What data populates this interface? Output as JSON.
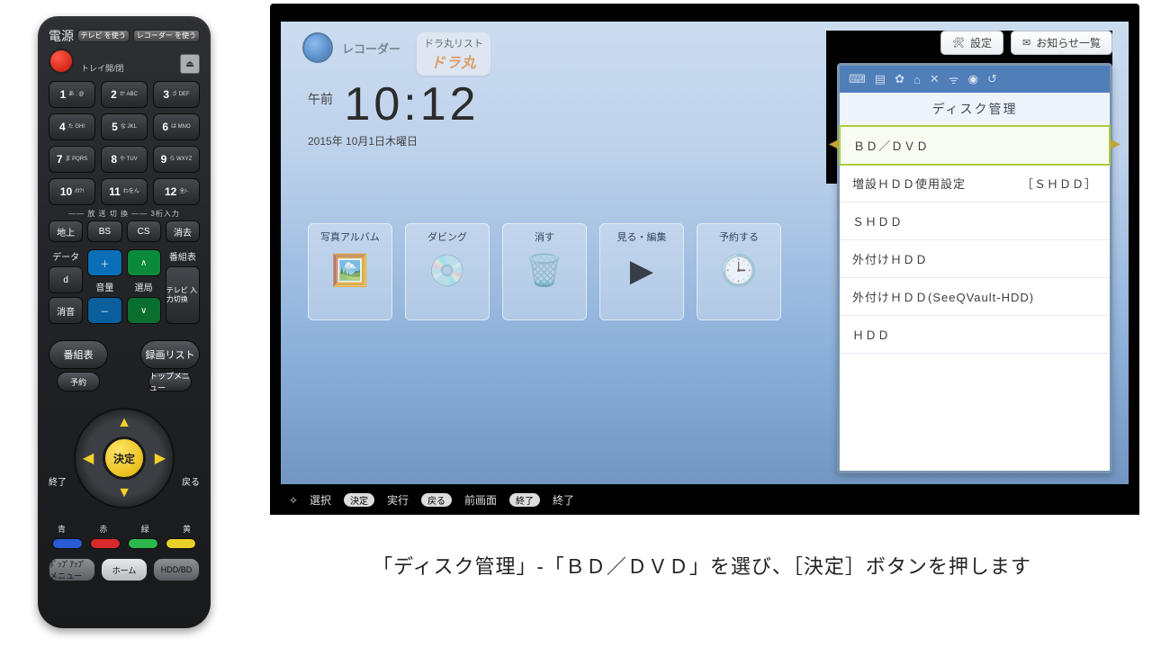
{
  "remote": {
    "power_label": "電源",
    "top_mini": {
      "tv": "テレビ\nを使う",
      "rec": "レコーダー\nを使う"
    },
    "tray": "トレイ開/閉",
    "numpad": [
      {
        "n": "1",
        "s": "あ\n. @"
      },
      {
        "n": "2",
        "s": "か\nABC"
      },
      {
        "n": "3",
        "s": "さ\nDEF"
      },
      {
        "n": "4",
        "s": "た\nGHI"
      },
      {
        "n": "5",
        "s": "な\nJKL"
      },
      {
        "n": "6",
        "s": "は\nMNO"
      },
      {
        "n": "7",
        "s": "ま\nPQRS"
      },
      {
        "n": "8",
        "s": "や\nTUV"
      },
      {
        "n": "9",
        "s": "ら\nWXYZ"
      },
      {
        "n": "10",
        "s": "/0?!"
      },
      {
        "n": "11",
        "s": "わをん"
      },
      {
        "n": "12",
        "s": "全/-"
      }
    ],
    "div": "―― 放 送 切 換 ―― 3桁入力",
    "src": [
      "地上",
      "BS",
      "CS",
      "消去"
    ],
    "left_col": {
      "data": "データ",
      "d": "d",
      "mute": "消音"
    },
    "vol": "音量",
    "ch": "選局",
    "right_col": {
      "epg": "番組表",
      "input": "テレビ\n入力切換"
    },
    "ovals": {
      "guide": "番組表",
      "reclist": "録画リスト",
      "resv": "予約",
      "topmenu": "トップメニュー"
    },
    "ok": "決定",
    "side": {
      "end": "終了",
      "back": "戻る"
    },
    "colors": [
      "青",
      "赤",
      "緑",
      "黄"
    ],
    "bottom": [
      "ﾎﾟｯﾌﾟｱｯﾌﾟ\nメニュー",
      "ホーム",
      "HDD/BD"
    ]
  },
  "tv": {
    "recorder": "レコーダー",
    "dora": {
      "title": "ドラ丸リスト",
      "logo": "ドラ丸"
    },
    "ampm": "午前",
    "time": "10:12",
    "date": "2015年 10月1日木曜日",
    "top_buttons": {
      "settings": "設定",
      "notice": "お知らせ一覧"
    },
    "tiles": [
      "写真アルバム",
      "ダビング",
      "消す",
      "見る・編集",
      "予約する"
    ],
    "tile_icons": [
      "🖼️",
      "💿",
      "🗑️",
      "▶",
      "🕒"
    ],
    "panel": {
      "title": "ディスク管理",
      "items": [
        {
          "label": "ＢＤ／ＤＶＤ",
          "suffix": "",
          "selected": true
        },
        {
          "label": "増設ＨＤＤ使用設定",
          "suffix": "［ＳＨＤＤ］"
        },
        {
          "label": "ＳＨＤＤ",
          "suffix": ""
        },
        {
          "label": "外付けＨＤＤ",
          "suffix": ""
        },
        {
          "label": "外付けＨＤＤ(SeeQVault-HDD)",
          "suffix": ""
        },
        {
          "label": "ＨＤＤ",
          "suffix": ""
        }
      ]
    },
    "footer": {
      "select": "選択",
      "exec_tag": "決定",
      "exec": "実行",
      "back_tag": "戻る",
      "back": "前画面",
      "end_tag": "終了",
      "end": "終了"
    }
  },
  "caption": "「ディスク管理」-「ＢＤ／ＤＶＤ」を選び、［決定］ボタンを押します"
}
